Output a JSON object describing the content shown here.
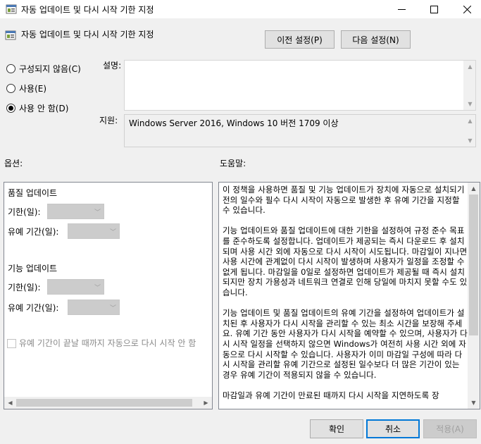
{
  "window": {
    "title": "자동 업데이트 및 다시 시작 기한 지정"
  },
  "header": {
    "policy_title": "자동 업데이트 및 다시 시작 기한 지정",
    "prev_button": "이전 설정(P)",
    "next_button": "다음 설정(N)"
  },
  "state": {
    "options": [
      {
        "label": "구성되지 않음(C)",
        "checked": false
      },
      {
        "label": "사용(E)",
        "checked": false
      },
      {
        "label": "사용 안 함(D)",
        "checked": true
      }
    ]
  },
  "comment": {
    "label": "설명:",
    "value": ""
  },
  "supported": {
    "label": "지원:",
    "value": "Windows Server 2016, Windows 10 버전 1709 이상"
  },
  "options_section": {
    "label": "옵션:",
    "quality_heading": "품질 업데이트",
    "quality_deadline_label": "기한(일):",
    "quality_grace_label": "유예 기간(일):",
    "feature_heading": "기능 업데이트",
    "feature_deadline_label": "기한(일):",
    "feature_grace_label": "유예 기간(일):",
    "no_auto_restart_label": "유예 기간이 끝날 때까지 자동으로 다시 시작 안 함"
  },
  "help_section": {
    "label": "도움말:",
    "paragraphs": [
      "이 정책을 사용하면 품질 및 기능 업데이트가 장치에 자동으로 설치되기 전의 일수와 필수 다시 시작이 자동으로 발생한 후 유예 기간을 지정할 수 있습니다.",
      "기능 업데이트와 품질 업데이트에 대한 기한을 설정하여 규정 준수 목표를 준수하도록 설정합니다. 업데이트가 제공되는 즉시 다운로드 후 설치되며 사용 시간 외에 자동으로 다시 시작이 시도됩니다. 마감일이 지나면 사용 시간에 관계없이 다시 시작이 발생하며 사용자가 일정을 조정할 수 없게 됩니다. 마감일을 0일로 설정하면 업데이트가 제공될 때 즉시 설치되지만 장치 가용성과 네트워크 연결로 인해 당일에 마치지 못할 수도 있습니다.",
      "기능 업데이트 및 품질 업데이트의 유예 기간을 설정하여 업데이트가 설치된 후 사용자가 다시 시작을 관리할 수 있는 최소 시간을 보장해 주세요. 유예 기간 동안 사용자가 다시 시작을 예약할 수 있으며, 사용자가 다시 시작 일정을 선택하지 않으면 Windows가 여전히 사용 시간 외에 자동으로 다시 시작할 수 있습니다. 사용자가 이미 마감일 구성에 따라 다시 시작을 관리할 유예 기간으로 설정된 일수보다 더 많은 기간이 있는 경우 유예 기간이 적용되지 않을 수 있습니다.",
      "마감일과 유예 기간이 만료된 때까지 다시 시작을 지연하도록 장"
    ]
  },
  "footer": {
    "ok_button": "확인",
    "cancel_button": "취소",
    "apply_button": "적용(A)"
  }
}
